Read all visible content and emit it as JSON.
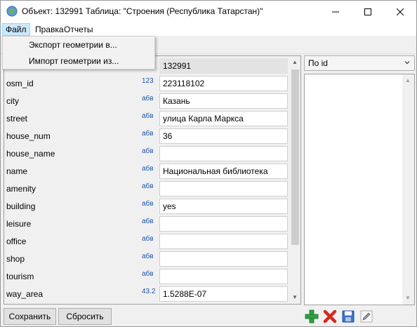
{
  "window": {
    "title": "Объект: 132991 Таблица: \"Строения (Республика Татарстан)\"",
    "min_icon": "minimize-icon",
    "max_icon": "maximize-icon",
    "close_icon": "close-icon"
  },
  "menu": {
    "file": "Файл",
    "edit": "Правка",
    "reports": "Отчеты",
    "file_items": [
      "Экспорт геометрии в...",
      "Импорт геометрии из..."
    ]
  },
  "attributes": [
    {
      "name": "",
      "type": "",
      "value": "132991",
      "readonly": true
    },
    {
      "name": "osm_id",
      "type": "123",
      "value": "223118102"
    },
    {
      "name": "city",
      "type": "абв",
      "value": "Казань"
    },
    {
      "name": "street",
      "type": "абв",
      "value": "улица Карла Маркса"
    },
    {
      "name": "house_num",
      "type": "абв",
      "value": "36"
    },
    {
      "name": "house_name",
      "type": "абв",
      "value": ""
    },
    {
      "name": "name",
      "type": "абв",
      "value": "Национальная библиотека"
    },
    {
      "name": "amenity",
      "type": "абв",
      "value": ""
    },
    {
      "name": "building",
      "type": "абв",
      "value": "yes"
    },
    {
      "name": "leisure",
      "type": "абв",
      "value": ""
    },
    {
      "name": "office",
      "type": "абв",
      "value": ""
    },
    {
      "name": "shop",
      "type": "абв",
      "value": ""
    },
    {
      "name": "tourism",
      "type": "абв",
      "value": ""
    },
    {
      "name": "way_area",
      "type": "43.2",
      "value": "1.5288E-07"
    }
  ],
  "right_panel": {
    "sort_value": "По id"
  },
  "buttons": {
    "save": "Сохранить",
    "reset": "Сбросить"
  },
  "toolbar_icons": [
    "add-icon",
    "delete-icon",
    "save-disk-icon",
    "edit-pencil-icon"
  ],
  "colors": {
    "type_label": "#1a56b0",
    "menu_highlight": "#cce8ff",
    "add_green": "#2ea043",
    "delete_red": "#d42a1f"
  }
}
